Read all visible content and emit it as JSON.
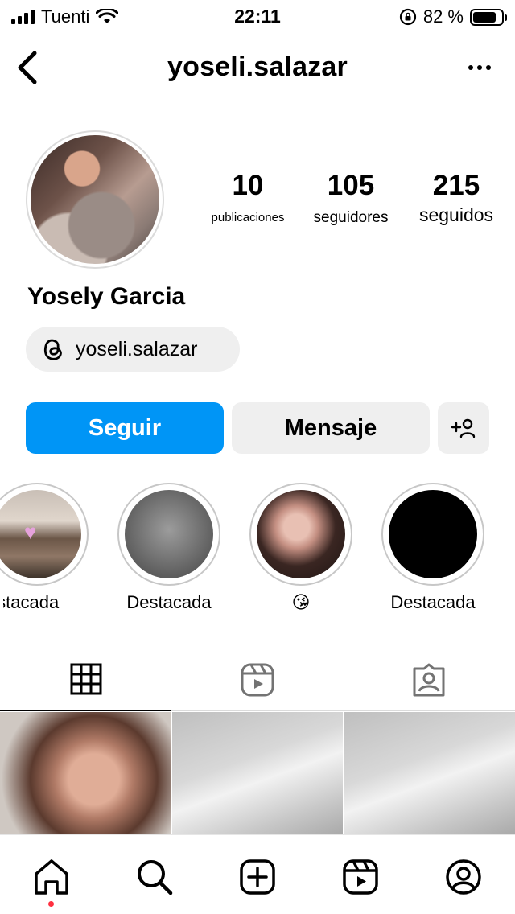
{
  "status_bar": {
    "carrier": "Tuenti",
    "time": "22:11",
    "battery_text": "82 %",
    "battery_level": 0.82
  },
  "header": {
    "username": "yoseli.salazar",
    "back_icon": "chevron-left-icon",
    "more_icon": "more-horizontal-icon"
  },
  "profile": {
    "display_name": "Yosely Garcia",
    "threads_handle": "yoseli.salazar",
    "stats": [
      {
        "value": "10",
        "label": "publicaciones"
      },
      {
        "value": "105",
        "label": "seguidores"
      },
      {
        "value": "215",
        "label": "seguidos"
      }
    ]
  },
  "actions": {
    "follow_label": "Seguir",
    "message_label": "Mensaje",
    "accent_color": "#0095f6"
  },
  "highlights": [
    {
      "label": "Destacada"
    },
    {
      "label": "Destacada"
    },
    {
      "label": "😘"
    },
    {
      "label": "Destacada"
    }
  ],
  "tabs": [
    {
      "icon": "grid-icon",
      "active": true
    },
    {
      "icon": "reels-icon",
      "active": false
    },
    {
      "icon": "tagged-icon",
      "active": false
    }
  ],
  "bottom_nav": [
    {
      "icon": "home-icon"
    },
    {
      "icon": "search-icon"
    },
    {
      "icon": "create-icon"
    },
    {
      "icon": "reels-icon"
    },
    {
      "icon": "profile-icon"
    }
  ]
}
